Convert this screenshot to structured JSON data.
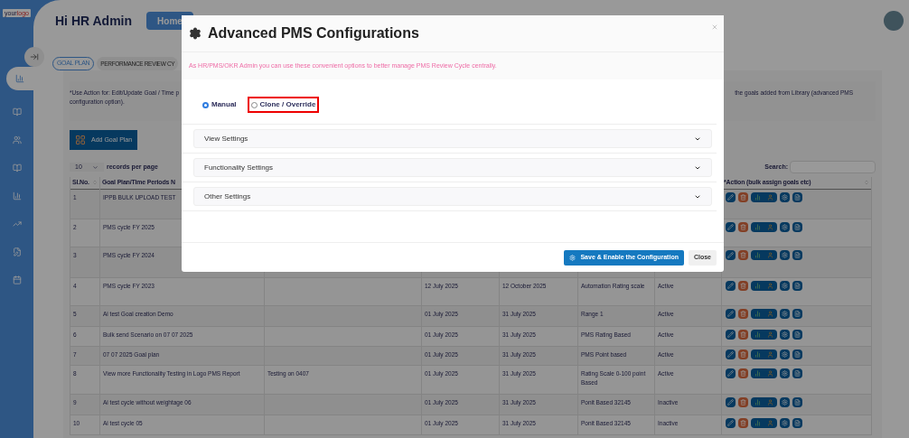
{
  "logo": {
    "part_1": "your",
    "part_2": "logo"
  },
  "sidebar": {
    "items": [
      {
        "selected": true
      },
      {
        "selected": false
      },
      {
        "selected": false
      },
      {
        "selected": false
      },
      {
        "selected": false
      },
      {
        "selected": false
      },
      {
        "selected": false
      },
      {
        "selected": false
      }
    ]
  },
  "header": {
    "greeting": "Hi HR Admin",
    "home_button": "Home"
  },
  "tabs": [
    {
      "label": "GOAL PLAN",
      "selected": true
    },
    {
      "label": "PERFORMANCE REVIEW CY",
      "selected": false
    }
  ],
  "info": {
    "left_lines": [
      "*Use Action for: Edit/Update Goal / Time p",
      "configuration option)."
    ],
    "right_line": "the goals added from Library (advanced PMS"
  },
  "add_button": "Add Goal Plan",
  "page_size": {
    "value": "10",
    "label": "records per page"
  },
  "search": {
    "label": "Search:"
  },
  "table": {
    "columns": [
      "Sl.No.",
      "Goal Plan/Time Periods N",
      "",
      "",
      "",
      "",
      "",
      "*Action (bulk assign goals etc)"
    ],
    "rows": [
      {
        "cells": [
          "1",
          "IPPB BULK UPLOAD TEST",
          "",
          "",
          "",
          "",
          ""
        ]
      },
      {
        "cells": [
          "2",
          "PMS cycle FY 2025",
          "",
          "",
          "",
          "",
          ""
        ]
      },
      {
        "cells": [
          "3",
          "PMS cycle FY 2024",
          "",
          "",
          "",
          "",
          ""
        ]
      },
      {
        "cells": [
          "4",
          "PMS cycle FY 2023",
          "",
          "12 July 2025",
          "12 October 2025",
          "Automation Rating scale",
          "Active"
        ]
      },
      {
        "cells": [
          "5",
          "Ai test Goal creation Demo",
          "",
          "01 July 2025",
          "31 July 2025",
          "Range 1",
          "Active"
        ]
      },
      {
        "cells": [
          "6",
          "Bulk send Scenario on 07 07 2025",
          "",
          "01 July 2025",
          "31 July 2025",
          "PMS Rating Based",
          "Active"
        ]
      },
      {
        "cells": [
          "7",
          "07 07 2025 Goal plan",
          "",
          "01 July 2025",
          "31 July 2025",
          "PMS Point based",
          "Active"
        ]
      },
      {
        "cells": [
          "8",
          "View more Functionality Testing in Logo PMS Report",
          "Testing on 0407",
          "01 July 2025",
          "31 July 2025",
          "Rating Scale 0-100 point Based",
          "Active"
        ]
      },
      {
        "cells": [
          "9",
          "Ai test cycle without weightage 06",
          "",
          "01 July 2025",
          "31 July 2025",
          "Ponit Based 32145",
          "Inactive"
        ]
      },
      {
        "cells": [
          "10",
          "Ai test cycle 05",
          "",
          "01 July 2025",
          "31 July 2025",
          "Ponit Based 32145",
          "Inactive"
        ]
      }
    ]
  },
  "modal": {
    "title": "Advanced PMS Configurations",
    "note": "As HR/PMS/OKR Admin you can use these convenient options to better manage PMS Review Cycle centrally.",
    "modes": [
      {
        "label": "Manual",
        "selected": true,
        "highlighted": false
      },
      {
        "label": "Clone / Override",
        "selected": false,
        "highlighted": true
      }
    ],
    "sections": [
      {
        "label": "View Settings",
        "expanded": false
      },
      {
        "label": "Functionality Settings",
        "expanded": false
      },
      {
        "label": "Other Settings",
        "expanded": false
      }
    ],
    "save_button": "Save & Enable the Configuration",
    "close_button": "Close"
  }
}
